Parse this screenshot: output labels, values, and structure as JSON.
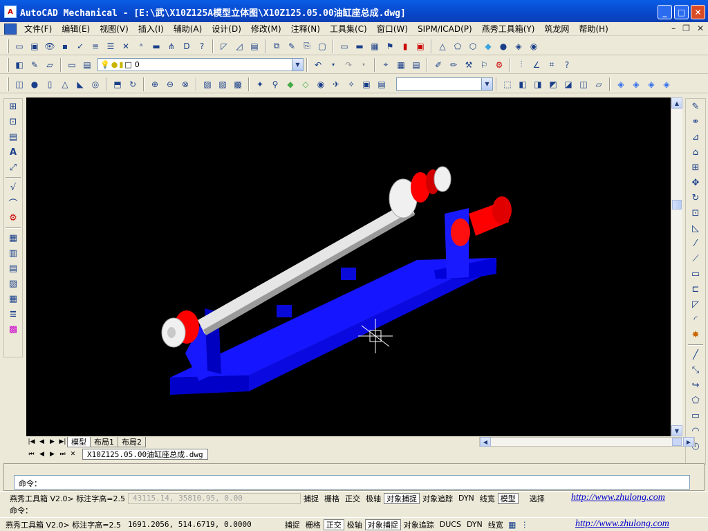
{
  "window": {
    "title": "AutoCAD Mechanical - [E:\\武\\X10Z125A模型立体图\\X10Z125.05.00油缸座总成.dwg]",
    "app_icon": "A"
  },
  "menu": {
    "items": [
      "文件(F)",
      "编辑(E)",
      "视图(V)",
      "插入(I)",
      "辅助(A)",
      "设计(D)",
      "修改(M)",
      "注释(N)",
      "工具集(C)",
      "窗口(W)",
      "SIPM/ICAD(P)",
      "燕秀工具箱(Y)",
      "筑龙网",
      "帮助(H)"
    ]
  },
  "toolbar2": {
    "layer_value": "0"
  },
  "layout_tabs": [
    "模型",
    "布局1",
    "布局2"
  ],
  "doc_tab": "X10Z125.05.00油缸座总成.dwg",
  "command": {
    "prompt": "命令："
  },
  "status1": {
    "plugin": "燕秀工具箱 V2.0> 标注字高=2.5",
    "coords": "43115.14, 35810.95, 0.00",
    "buttons": [
      "捕捉",
      "栅格",
      "正交",
      "极轴",
      "对象捕捉",
      "对象追踪",
      "DYN",
      "线宽",
      "模型"
    ],
    "extra": "选择",
    "link": "http://www.zhulong.com"
  },
  "status2": {
    "partial": "命令：",
    "plugin": "燕秀工具箱 V2.0> 标注字高=2.5",
    "coords": "1691.2056, 514.6719, 0.0000",
    "buttons": [
      "捕捉",
      "栅格",
      "正交",
      "极轴",
      "对象捕捉",
      "对象追踪",
      "DUCS",
      "DYN",
      "线宽"
    ],
    "link": "http://www.zhulong.com"
  },
  "colors": {
    "titlebar": "#0a4fd6",
    "viewport_bg": "#000000",
    "frame_blue": "#0a0aff",
    "shaft_white": "#e6e6e6",
    "gear_red": "#ff0000"
  }
}
